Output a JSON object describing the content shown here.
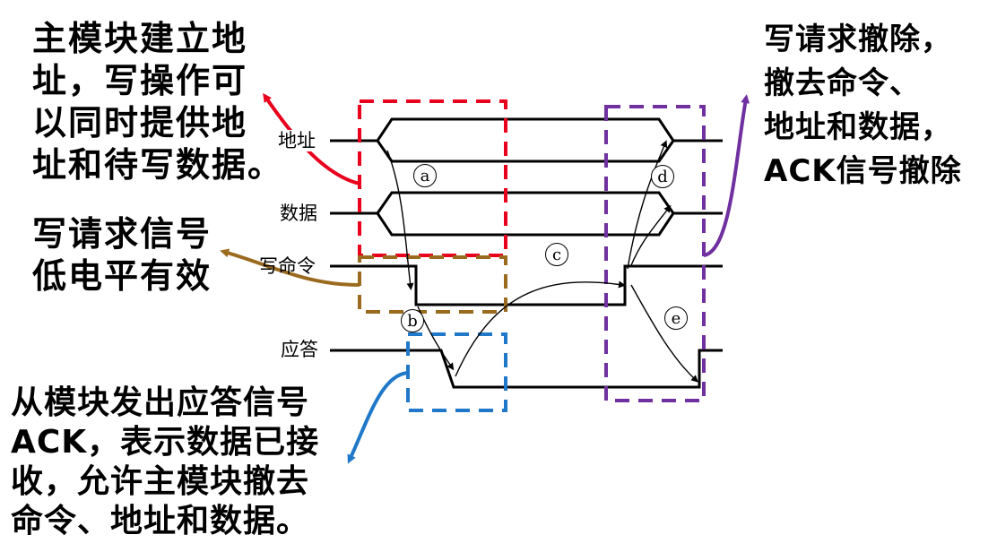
{
  "annotations": {
    "top_left": [
      "主模块建立地",
      "址，写操作可",
      "以同时提供地",
      "址和待写数据。"
    ],
    "mid_left": [
      "写请求信号",
      "低电平有效"
    ],
    "bottom_left": [
      "从模块发出应答信号",
      "ACK，表示数据已接",
      "收，允许主模块撤去",
      "命令、地址和数据。"
    ],
    "top_right": [
      "写请求撤除，",
      "撤去命令、",
      "地址和数据，",
      "ACK信号撤除"
    ]
  },
  "signals": {
    "address": "地址",
    "data": "数据",
    "write_cmd": "写命令",
    "ack": "应答"
  },
  "steps": [
    "a",
    "b",
    "c",
    "d",
    "e"
  ],
  "colors": {
    "red": "#e8001c",
    "brown": "#9a6b1e",
    "blue": "#1f78c8",
    "purple": "#7030a0",
    "line": "#000000"
  }
}
